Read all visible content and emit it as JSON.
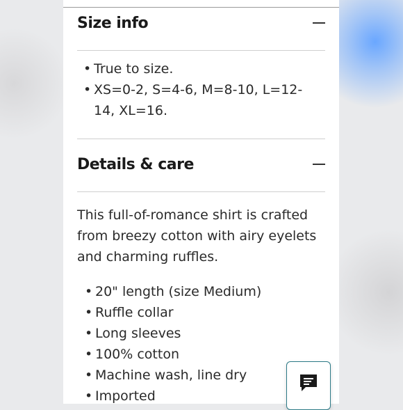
{
  "size_info": {
    "title": "Size info",
    "items": [
      "True to size.",
      "XS=0-2, S=4-6, M=8-10, L=12-14, XL=16."
    ]
  },
  "details_care": {
    "title": "Details & care",
    "description": "This full-of-romance shirt is crafted from breezy cotton with airy eyelets and charming ruffles.",
    "items": [
      "20\" length (size Medium)",
      "Ruffle collar",
      "Long sleeves",
      "100% cotton",
      "Machine wash, line dry",
      "Imported"
    ]
  },
  "icons": {
    "collapse": "minus-icon",
    "chat": "chat-bubble-icon"
  },
  "colors": {
    "chat_border": "#2c7a87",
    "chat_icon": "#1a1a1a"
  }
}
